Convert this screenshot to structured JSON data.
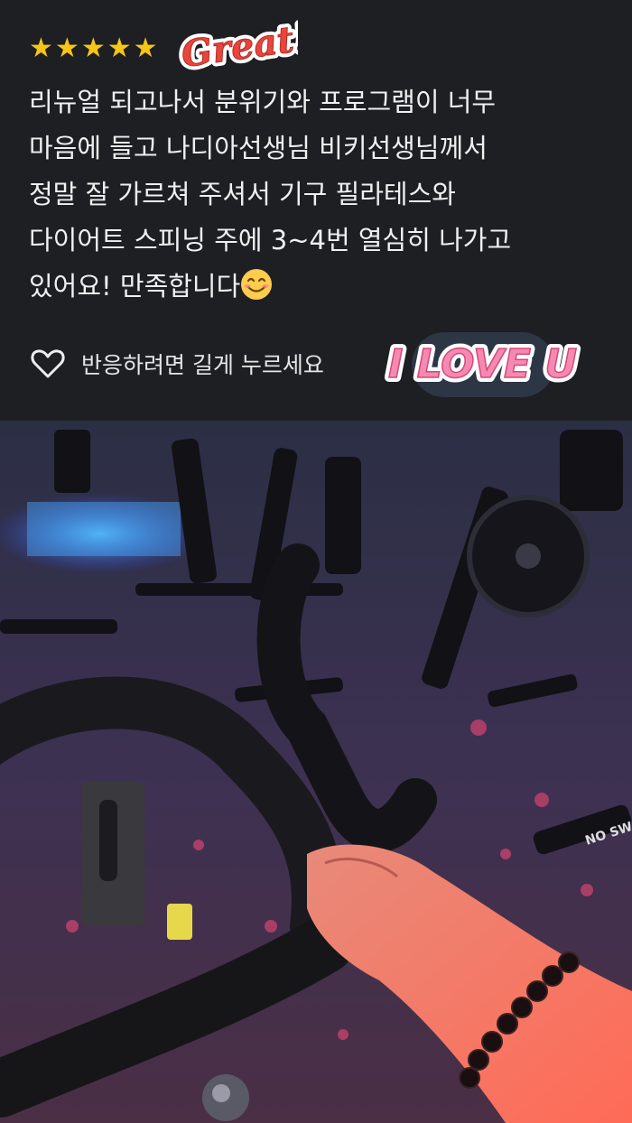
{
  "review": {
    "rating": 5,
    "stars": [
      "★",
      "★",
      "★",
      "★",
      "★"
    ],
    "sticker_great": "Great!",
    "text": "리뉴얼 되고나서 분위기와 프로그램이 너무\n마음에 들고 나디아선생님 비키선생님께서\n정말 잘 가르쳐 주셔서 기구 필라테스와\n다이어트 스피닝 주에 3~4번 열심히 나가고\n있어요! 만족합니다",
    "emoji": "smiling-face-emoji",
    "react_label": "반응하려면 길게 누르세요",
    "heart_icon": "heart-outline-icon",
    "sticker_love": "I LOVE U"
  },
  "photo": {
    "description_icon": "spinning-studio-photo",
    "bike_label_1": "NO SW"
  },
  "colors": {
    "background": "#1e1f22",
    "star": "#f5c518",
    "sticker_red": "#e8453c",
    "sticker_pink": "#f58ab0"
  }
}
